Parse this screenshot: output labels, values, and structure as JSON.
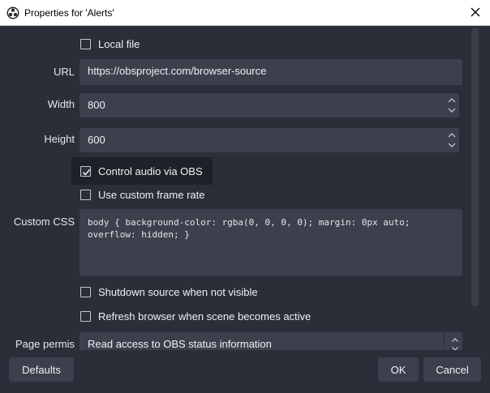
{
  "window": {
    "title": "Properties for 'Alerts'"
  },
  "form": {
    "local_file_label": "Local file",
    "url_label": "URL",
    "url_value": "https://obsproject.com/browser-source",
    "width_label": "Width",
    "width_value": "800",
    "height_label": "Height",
    "height_value": "600",
    "control_audio_label": "Control audio via OBS",
    "custom_frame_rate_label": "Use custom frame rate",
    "custom_css_label": "Custom CSS",
    "custom_css_value": "body { background-color: rgba(0, 0, 0, 0); margin: 0px auto;\noverflow: hidden; }",
    "shutdown_label": "Shutdown source when not visible",
    "refresh_label": "Refresh browser when scene becomes active",
    "page_permissions_label": "Page permis",
    "page_permissions_value": "Read access to OBS status information"
  },
  "buttons": {
    "defaults": "Defaults",
    "ok": "OK",
    "cancel": "Cancel"
  },
  "colors": {
    "background": "#2b2e38",
    "field": "#3c404d",
    "titlebar": "#ffffff"
  }
}
